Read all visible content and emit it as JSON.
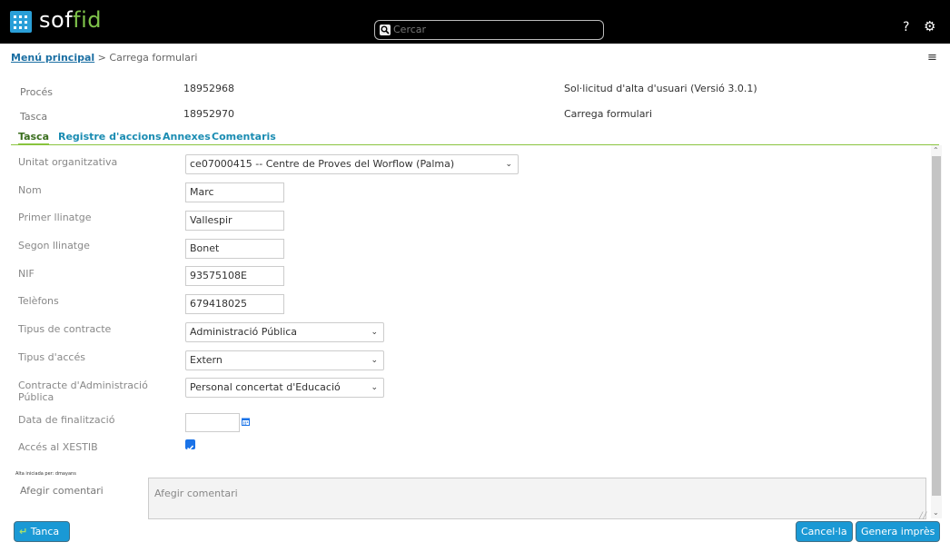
{
  "header": {
    "logo_part1": "sof",
    "logo_part2": "fid",
    "search_placeholder": "Cercar",
    "help_label": "?"
  },
  "breadcrumb": {
    "home": "Menú principal",
    "separator": ">",
    "current": "Carrega formulari"
  },
  "info": {
    "proces_label": "Procés",
    "proces_id": "18952968",
    "proces_name": "Sol·licitud d'alta d'usuari (Versió 3.0.1)",
    "tasca_label": "Tasca",
    "tasca_id": "18952970",
    "tasca_name": "Carrega formulari"
  },
  "tabs": [
    "Tasca",
    "Registre d'accions",
    "Annexes",
    "Comentaris"
  ],
  "form": {
    "unitat_label": "Unitat organitzativa",
    "unitat_value": "ce07000415 -- Centre de Proves del Worflow (Palma)",
    "nom_label": "Nom",
    "nom_value": "Marc",
    "primer_label": "Primer llinatge",
    "primer_value": "Vallespir",
    "segon_label": "Segon llinatge",
    "segon_value": "Bonet",
    "nif_label": "NIF",
    "nif_value": "93575108E",
    "telefons_label": "Telèfons",
    "telefons_value": "679418025",
    "tipus_contracte_label": "Tipus de contracte",
    "tipus_contracte_value": "Administració Pública",
    "tipus_acces_label": "Tipus d'accés",
    "tipus_acces_value": "Extern",
    "contracte_admin_label": "Contracte d'Administració Pública",
    "contracte_admin_value": "Personal concertat d'Educació",
    "data_fin_label": "Data de finalització",
    "data_fin_value": "",
    "acces_xestib_label": "Accés al XESTIB",
    "acces_xestib_checked": true
  },
  "comment": {
    "initiator": "Alta iniciada per: dmayans",
    "label": "Afegir comentari",
    "placeholder": "Afegir comentari"
  },
  "buttons": {
    "tanca": "Tanca",
    "cancel": "Cancel·la",
    "genera": "Genera imprès"
  },
  "colors": {
    "brand_blue": "#1a99d5",
    "brand_green": "#7fc34a",
    "tab_active_underline": "#86c33a"
  }
}
